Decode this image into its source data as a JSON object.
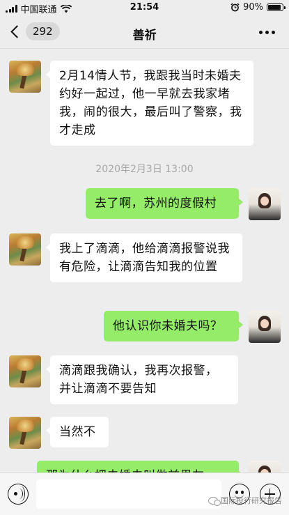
{
  "status_bar": {
    "carrier": "中国联通",
    "time": "21:54",
    "battery": "90%",
    "battery_level": 0.9
  },
  "nav": {
    "unread_count": "292",
    "title": "善祈"
  },
  "messages": [
    {
      "side": "left",
      "avatar": "tree-avatar",
      "text": "2月14情人节，我跟我当时未婚夫约好一起过，他一早就去我家堵我，闹的很大，最后叫了警察，我才走成"
    },
    {
      "type": "timestamp",
      "text": "2020年2月3日 13:00"
    },
    {
      "side": "right",
      "avatar": "person-avatar",
      "text": "去了啊，苏州的度假村"
    },
    {
      "side": "left",
      "avatar": "tree-avatar",
      "text": "我上了滴滴，他给滴滴报警说我有危险，让滴滴告知我的位置"
    },
    {
      "side": "right",
      "avatar": "person-avatar",
      "text": "他认识你未婚夫吗？"
    },
    {
      "side": "left",
      "avatar": "tree-avatar",
      "text": "滴滴跟我确认，我再次报警，并让滴滴不要告知"
    },
    {
      "side": "left",
      "avatar": "tree-avatar",
      "text": "当然不"
    },
    {
      "side": "right",
      "avatar": "person-avatar",
      "text": "那为什么把未婚夫叫做前男友"
    }
  ],
  "watermark": "国际投行研究报告",
  "icons": {
    "back": "chevron-left-icon",
    "more": "more-dots-icon",
    "voice": "voice-icon",
    "emoji": "emoji-icon",
    "plus": "plus-icon",
    "wifi": "wifi-icon",
    "alarm": "alarm-icon"
  }
}
